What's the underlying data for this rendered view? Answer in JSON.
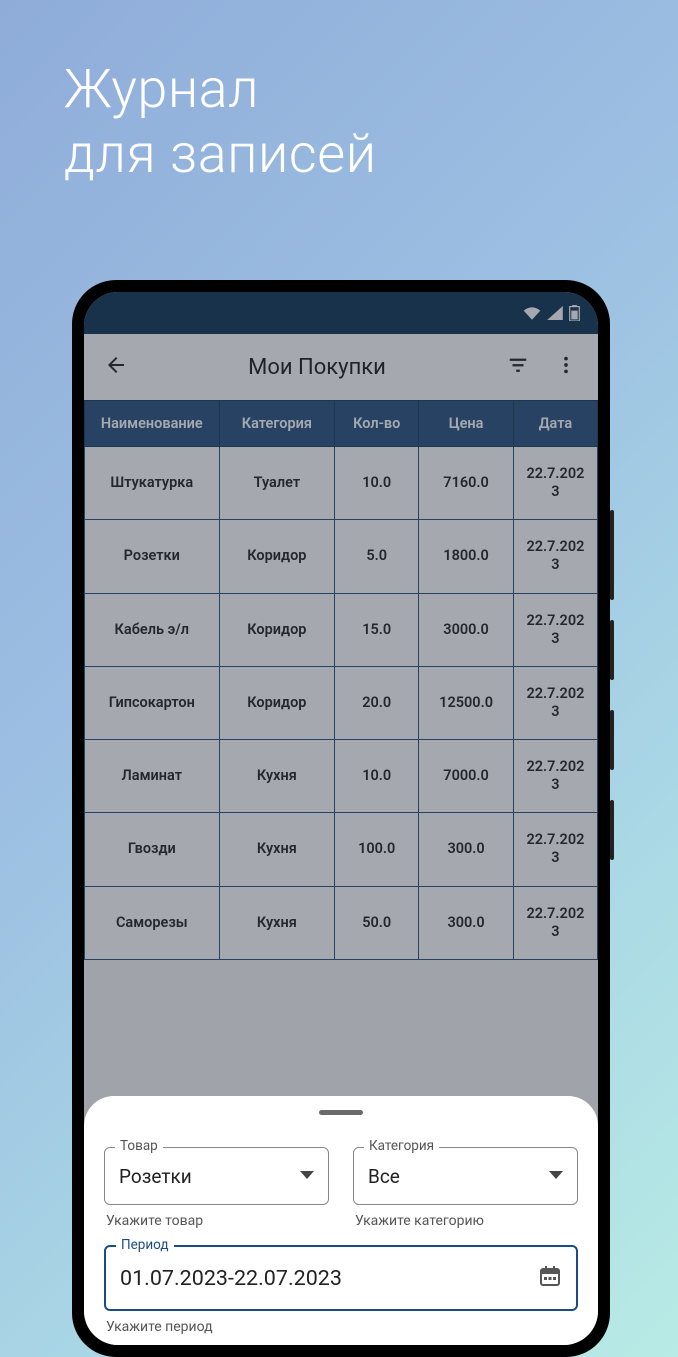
{
  "hero": {
    "line1": "Журнал",
    "line2": "для записей"
  },
  "appbar": {
    "title": "Мои Покупки"
  },
  "table": {
    "headers": {
      "name": "Наименование",
      "category": "Категория",
      "qty": "Кол-во",
      "price": "Цена",
      "date": "Дата"
    },
    "rows": [
      {
        "name": "Штукатурка",
        "category": "Туалет",
        "qty": "10.0",
        "price": "7160.0",
        "date": "22.7.2023"
      },
      {
        "name": "Розетки",
        "category": "Коридор",
        "qty": "5.0",
        "price": "1800.0",
        "date": "22.7.2023"
      },
      {
        "name": "Кабель э/л",
        "category": "Коридор",
        "qty": "15.0",
        "price": "3000.0",
        "date": "22.7.2023"
      },
      {
        "name": "Гипсокартон",
        "category": "Коридор",
        "qty": "20.0",
        "price": "12500.0",
        "date": "22.7.2023"
      },
      {
        "name": "Ламинат",
        "category": "Кухня",
        "qty": "10.0",
        "price": "7000.0",
        "date": "22.7.2023"
      },
      {
        "name": "Гвозди",
        "category": "Кухня",
        "qty": "100.0",
        "price": "300.0",
        "date": "22.7.2023"
      },
      {
        "name": "Саморезы",
        "category": "Кухня",
        "qty": "50.0",
        "price": "300.0",
        "date": "22.7.2023"
      }
    ]
  },
  "sheet": {
    "product": {
      "label": "Товар",
      "value": "Розетки",
      "helper": "Укажите товар"
    },
    "category": {
      "label": "Категория",
      "value": "Все",
      "helper": "Укажите категорию"
    },
    "period": {
      "label": "Период",
      "value": "01.07.2023-22.07.2023",
      "helper": "Укажите период"
    }
  }
}
